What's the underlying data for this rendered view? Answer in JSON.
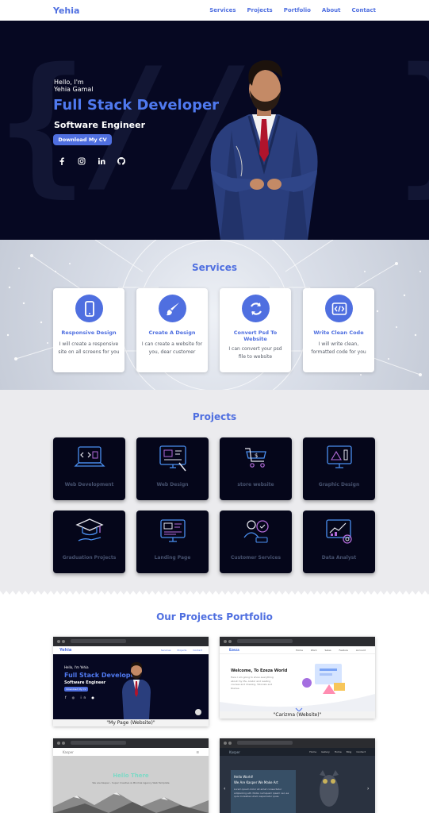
{
  "nav": {
    "brand": "Yehia",
    "links": [
      "Services",
      "Projects",
      "Portfolio",
      "About",
      "Contact"
    ]
  },
  "hero": {
    "greeting": "Hello, I'm",
    "name": "Yehia Gamal",
    "title": "Full Stack Developer",
    "subtitle": "Software Engineer",
    "cv_button": "Download My CV",
    "socials": [
      "facebook-icon",
      "instagram-icon",
      "linkedin-icon",
      "github-icon"
    ],
    "accent": "#4f6fe0",
    "background": "#060822"
  },
  "services": {
    "title": "Services",
    "items": [
      {
        "icon": "mobile-icon",
        "title": "Responsive Design",
        "desc": "I will create a responsive site on all screens for you"
      },
      {
        "icon": "brush-icon",
        "title": "Create A Design",
        "desc": "I can create a website for you, dear customer"
      },
      {
        "icon": "sync-icon",
        "title": "Convert Psd To Website",
        "desc": "I can convert your psd file to website"
      },
      {
        "icon": "code-icon",
        "title": "Write Clean Code",
        "desc": "I will write clean, formatted code for you"
      }
    ]
  },
  "projects": {
    "title": "Projects",
    "items": [
      {
        "icon": "web-development-icon",
        "label": "Web Development"
      },
      {
        "icon": "web-design-icon",
        "label": "Web Design"
      },
      {
        "icon": "store-icon",
        "label": "store website"
      },
      {
        "icon": "graphic-design-icon",
        "label": "Graphic Design"
      },
      {
        "icon": "graduation-cap-icon",
        "label": "Graduation Projects"
      },
      {
        "icon": "landing-page-icon",
        "label": "Landing Page"
      },
      {
        "icon": "customer-services-icon",
        "label": "Customer Services"
      },
      {
        "icon": "data-analyst-icon",
        "label": "Data Analyst"
      }
    ]
  },
  "portfolio": {
    "title": "Our Projects Portfolio",
    "items": [
      {
        "caption": "\"My Page (Website)\"",
        "preview": {
          "brand": "Yehia",
          "links": [
            "Services",
            "Projects",
            "Contact"
          ],
          "greeting": "Hello, I'm Yehia",
          "title": "Full Stack Developer",
          "subtitle": "Software Engineer",
          "button": "Download My CV"
        }
      },
      {
        "caption": "\"Carizma (Website)\"",
        "preview": {
          "brand": "Ezeza",
          "links": [
            "Home",
            "Work",
            "Sales",
            "Feature",
            "Account"
          ],
          "heading": "Welcome, To Ezeza World",
          "text": "Here I am going to show everything about my life, Arabic and reading courses and drawing, Tutorials and Diaries."
        }
      },
      {
        "caption": "",
        "preview": {
          "brand": "Kasper",
          "menu": "☰",
          "heading": "Hello There",
          "text": "We are Kasper - Super Creative & Minimal Agency Web Template"
        }
      },
      {
        "caption": "",
        "preview": {
          "brand": "Kasper",
          "links": [
            "Home",
            "Gallery",
            "Home",
            "Blog",
            "Contact"
          ],
          "heading": "Hello World!",
          "heading2": "We Are Kasper We Make Art",
          "text": "Lorem ipsum dolor sit amet consectetur adipisicing elit. Nobis numquam ipsam vel, ea quis molestias ullam aspernatur quas."
        }
      }
    ]
  }
}
